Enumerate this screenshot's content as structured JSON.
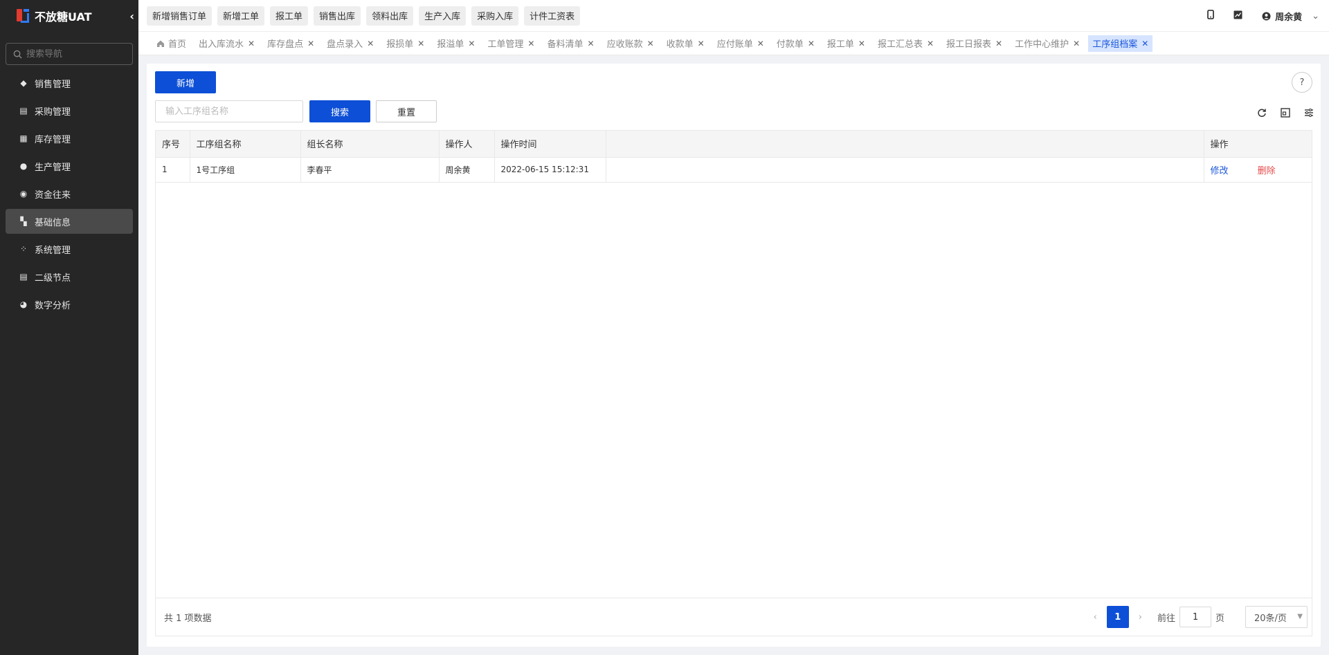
{
  "app": {
    "title": "不放糖UAT"
  },
  "sidebar": {
    "search_placeholder": "搜索导航",
    "items": [
      {
        "label": "销售管理",
        "icon": "tag-icon"
      },
      {
        "label": "采购管理",
        "icon": "cart-icon"
      },
      {
        "label": "库存管理",
        "icon": "warehouse-icon"
      },
      {
        "label": "生产管理",
        "icon": "production-icon"
      },
      {
        "label": "资金往来",
        "icon": "money-icon"
      },
      {
        "label": "基础信息",
        "icon": "dashboard-icon",
        "active": true
      },
      {
        "label": "系统管理",
        "icon": "apps-icon"
      },
      {
        "label": "二级节点",
        "icon": "document-icon"
      },
      {
        "label": "数字分析",
        "icon": "pie-chart-icon"
      }
    ]
  },
  "topbar": {
    "quick_actions": [
      "新增销售订单",
      "新增工单",
      "报工单",
      "销售出库",
      "领料出库",
      "生产入库",
      "采购入库",
      "计件工资表"
    ],
    "user_name": "周余黄"
  },
  "tabs": [
    {
      "label": "首页"
    },
    {
      "label": "出入库流水"
    },
    {
      "label": "库存盘点"
    },
    {
      "label": "盘点录入"
    },
    {
      "label": "报损单"
    },
    {
      "label": "报溢单"
    },
    {
      "label": "工单管理"
    },
    {
      "label": "备料清单"
    },
    {
      "label": "应收账款"
    },
    {
      "label": "收款单"
    },
    {
      "label": "应付账单"
    },
    {
      "label": "付款单"
    },
    {
      "label": "报工单"
    },
    {
      "label": "报工汇总表"
    },
    {
      "label": "报工日报表"
    },
    {
      "label": "工作中心维护"
    },
    {
      "label": "工序组档案",
      "active": true
    }
  ],
  "main": {
    "add_label": "新增",
    "search_placeholder": "输入工序组名称",
    "search_label": "搜索",
    "reset_label": "重置",
    "help": "?",
    "table": {
      "columns": [
        "序号",
        "工序组名称",
        "组长名称",
        "操作人",
        "操作时间",
        "",
        "操作"
      ],
      "rows": [
        {
          "index": "1",
          "group_name": "1号工序组",
          "leader": "李春平",
          "operator": "周余黄",
          "time": "2022-06-15 15:12:31",
          "edit": "修改",
          "delete": "删除"
        }
      ]
    },
    "footer": {
      "total": "共 1 项数据",
      "current_page": "1",
      "goto_label": "前往",
      "goto_value": "1",
      "page_unit": "页",
      "page_size": "20条/页"
    }
  }
}
